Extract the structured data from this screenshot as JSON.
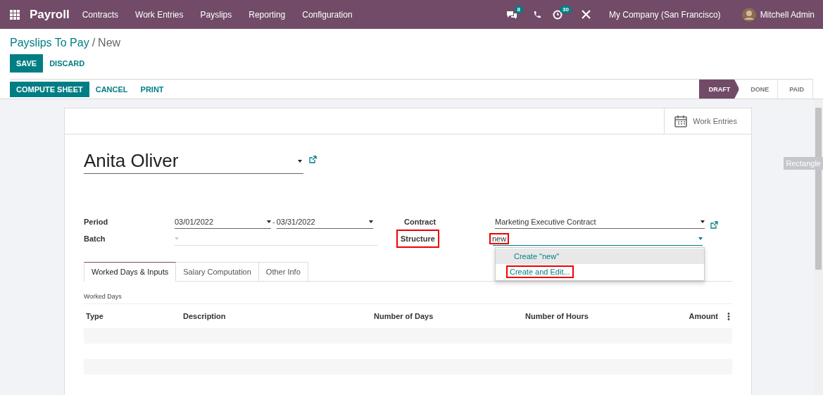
{
  "navbar": {
    "app": "Payroll",
    "menu": [
      "Contracts",
      "Work Entries",
      "Payslips",
      "Reporting",
      "Configuration"
    ],
    "messages_badge": "8",
    "activities_badge": "30",
    "company": "My Company (San Francisco)",
    "user": "Mitchell Admin"
  },
  "breadcrumb": {
    "parent": "Payslips To Pay",
    "separator": "/",
    "current": "New"
  },
  "form_buttons": [
    {
      "label": "SAVE",
      "kind": "primary"
    },
    {
      "label": "DISCARD",
      "kind": "link"
    }
  ],
  "actions": [
    {
      "label": "COMPUTE SHEET",
      "kind": "primary"
    },
    {
      "label": "CANCEL",
      "kind": "link"
    },
    {
      "label": "PRINT",
      "kind": "link"
    }
  ],
  "stages": [
    {
      "label": "DRAFT",
      "selected": true
    },
    {
      "label": "DONE",
      "selected": false
    },
    {
      "label": "PAID",
      "selected": false
    }
  ],
  "smart_button": "Work Entries",
  "employee": "Anita Oliver",
  "fields": {
    "period_label": "Period",
    "date_from": "03/01/2022",
    "date_separator": "-",
    "date_to": "03/31/2022",
    "batch_label": "Batch",
    "contract_label": "Contract",
    "contract": "Marketing Executive Contract",
    "structure_label": {
      "text": "Structure",
      "highlighted": true
    },
    "structure_value": {
      "text": "new",
      "highlighted": true
    }
  },
  "dropdown": [
    {
      "label": "Create \"new\"",
      "selected": true,
      "highlighted": false
    },
    {
      "label": "Create and Edit...",
      "selected": false,
      "highlighted": true
    }
  ],
  "tabs": [
    {
      "label": "Worked Days & Inputs",
      "selected": true
    },
    {
      "label": "Salary Computation",
      "selected": false
    },
    {
      "label": "Other Info",
      "selected": false
    }
  ],
  "section": "Worked Days",
  "columns": [
    "Type",
    "Description",
    "Number of Days",
    "Number of Hours",
    "Amount"
  ],
  "tooltip": "Rectangle"
}
